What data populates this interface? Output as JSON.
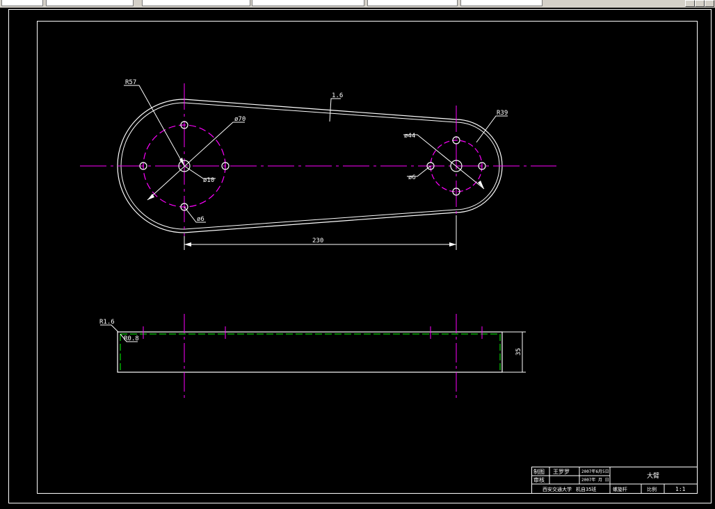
{
  "toolbar": {
    "tabs": [
      "",
      "",
      "",
      "",
      ""
    ],
    "controls": [
      "minimize",
      "restore",
      "close"
    ]
  },
  "drawing": {
    "colors": {
      "outline": "#ffffff",
      "centerline": "#ff00ff",
      "hidden": "#00ff00",
      "background": "#000000"
    },
    "dimensions": {
      "r57": "R57",
      "d70": "ø70",
      "d10": "ø10",
      "d6_left": "ø6",
      "r16_top": "1.6",
      "r39": "R39",
      "d44": "ø44",
      "d6_right": "ø6",
      "len230": "230",
      "r16_side": "R1.6",
      "r08": "R0.8",
      "h35": "35"
    },
    "title_block": {
      "drawn_label": "制图",
      "drawn_name": "王罗罗",
      "drawn_date": "2007年6月5日",
      "checked_label": "审核",
      "checked_date": "2007年 月 日",
      "school": "西安交通大学",
      "class_info": "机自35班",
      "part_name": "大臂",
      "part_code": "螺旋杆",
      "label_scale": "比例",
      "scale": "1:1"
    }
  }
}
